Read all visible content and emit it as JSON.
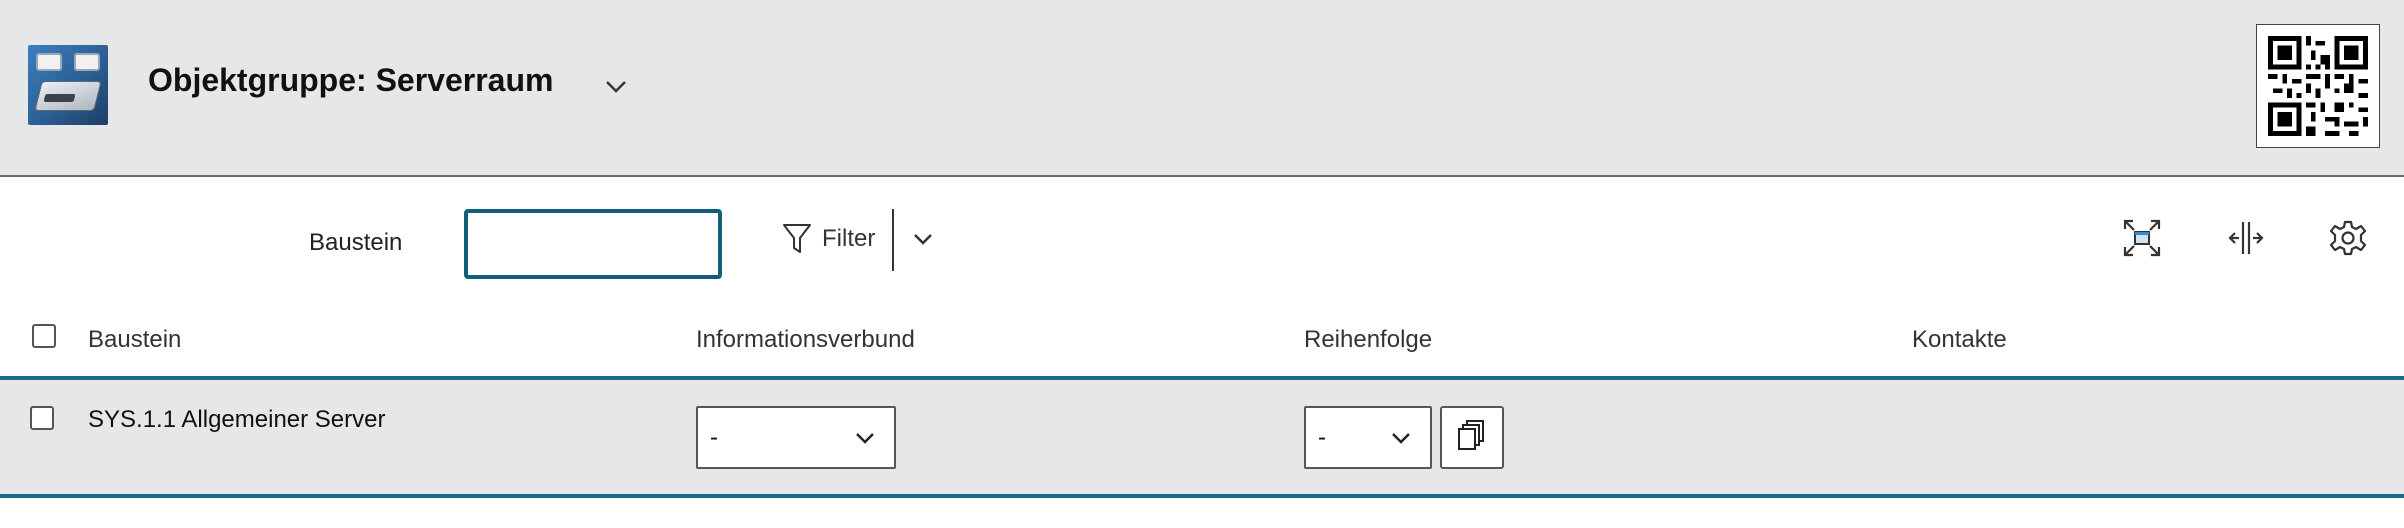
{
  "header": {
    "title": "Objektgruppe: Serverraum",
    "app_icon": "server-room-icon",
    "qr_icon": "qr-code-icon",
    "background": "#e6e7e8"
  },
  "filter_bar": {
    "label": "Baustein",
    "search_value": "",
    "filter_label": "Filter",
    "accent": "#135f7b",
    "tools": [
      "fullscreen-icon",
      "resize-columns-icon",
      "settings-gear-icon"
    ]
  },
  "table": {
    "columns": [
      "Baustein",
      "Informationsverbund",
      "Reihenfolge",
      "Kontakte"
    ],
    "rows": [
      {
        "baustein": "SYS.1.1 Allgemeiner Server",
        "informationsverbund": "-",
        "reihenfolge": "-",
        "kontakte": ""
      }
    ],
    "row_background": "#e6e7e8",
    "line_color": "#1b6a87"
  }
}
